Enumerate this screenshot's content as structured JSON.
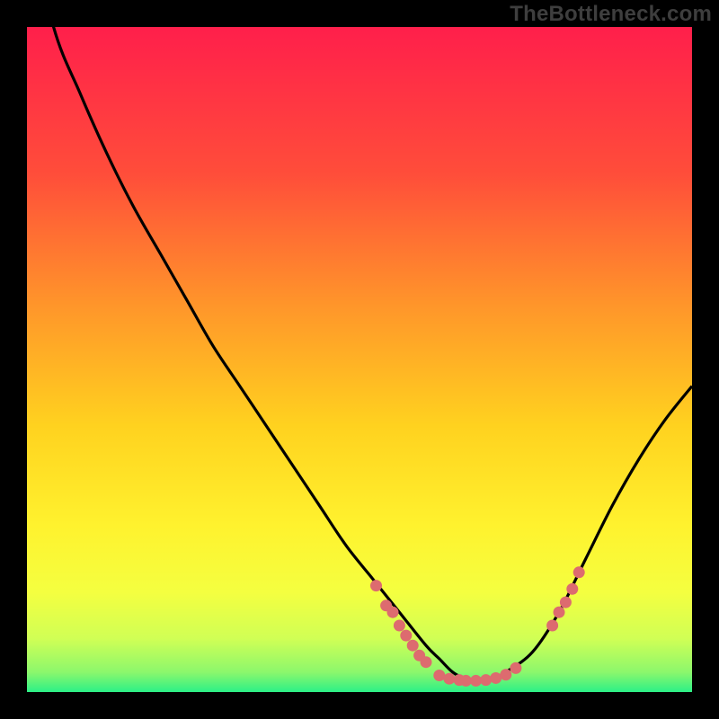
{
  "watermark": "TheBottleneck.com",
  "colors": {
    "background": "#000000",
    "gradient_top": "#ff1f4b",
    "gradient_mid1": "#ff6a2a",
    "gradient_mid2": "#ffd21f",
    "gradient_mid3": "#faff3a",
    "gradient_mid4": "#d8ff5a",
    "gradient_bottom": "#2cf087",
    "curve": "#000000",
    "points": "#dd6b6f"
  },
  "chart_data": {
    "type": "line",
    "title": "",
    "xlabel": "",
    "ylabel": "",
    "xlim": [
      0,
      100
    ],
    "ylim": [
      0,
      100
    ],
    "series": [
      {
        "name": "bottleneck-curve",
        "x": [
          0,
          4,
          8,
          12,
          16,
          20,
          24,
          28,
          32,
          36,
          40,
          44,
          48,
          52,
          56,
          60,
          62,
          64,
          66,
          68,
          70,
          72,
          76,
          80,
          84,
          88,
          92,
          96,
          100
        ],
        "values": [
          118,
          100,
          90,
          81,
          73,
          66,
          59,
          52,
          46,
          40,
          34,
          28,
          22,
          17,
          12,
          7,
          5,
          3,
          2,
          2,
          2,
          3,
          6,
          12,
          20,
          28,
          35,
          41,
          46
        ]
      }
    ],
    "scatter_points": [
      {
        "x": 52.5,
        "y": 16
      },
      {
        "x": 54.0,
        "y": 13
      },
      {
        "x": 55.0,
        "y": 12
      },
      {
        "x": 56.0,
        "y": 10
      },
      {
        "x": 57.0,
        "y": 8.5
      },
      {
        "x": 58.0,
        "y": 7
      },
      {
        "x": 59.0,
        "y": 5.5
      },
      {
        "x": 60.0,
        "y": 4.5
      },
      {
        "x": 62.0,
        "y": 2.5
      },
      {
        "x": 63.5,
        "y": 2.0
      },
      {
        "x": 65.0,
        "y": 1.8
      },
      {
        "x": 66.0,
        "y": 1.7
      },
      {
        "x": 67.5,
        "y": 1.7
      },
      {
        "x": 69.0,
        "y": 1.8
      },
      {
        "x": 70.5,
        "y": 2.1
      },
      {
        "x": 72.0,
        "y": 2.6
      },
      {
        "x": 73.5,
        "y": 3.6
      },
      {
        "x": 79.0,
        "y": 10
      },
      {
        "x": 80.0,
        "y": 12
      },
      {
        "x": 81.0,
        "y": 13.5
      },
      {
        "x": 82.0,
        "y": 15.5
      },
      {
        "x": 83.0,
        "y": 18
      }
    ]
  }
}
